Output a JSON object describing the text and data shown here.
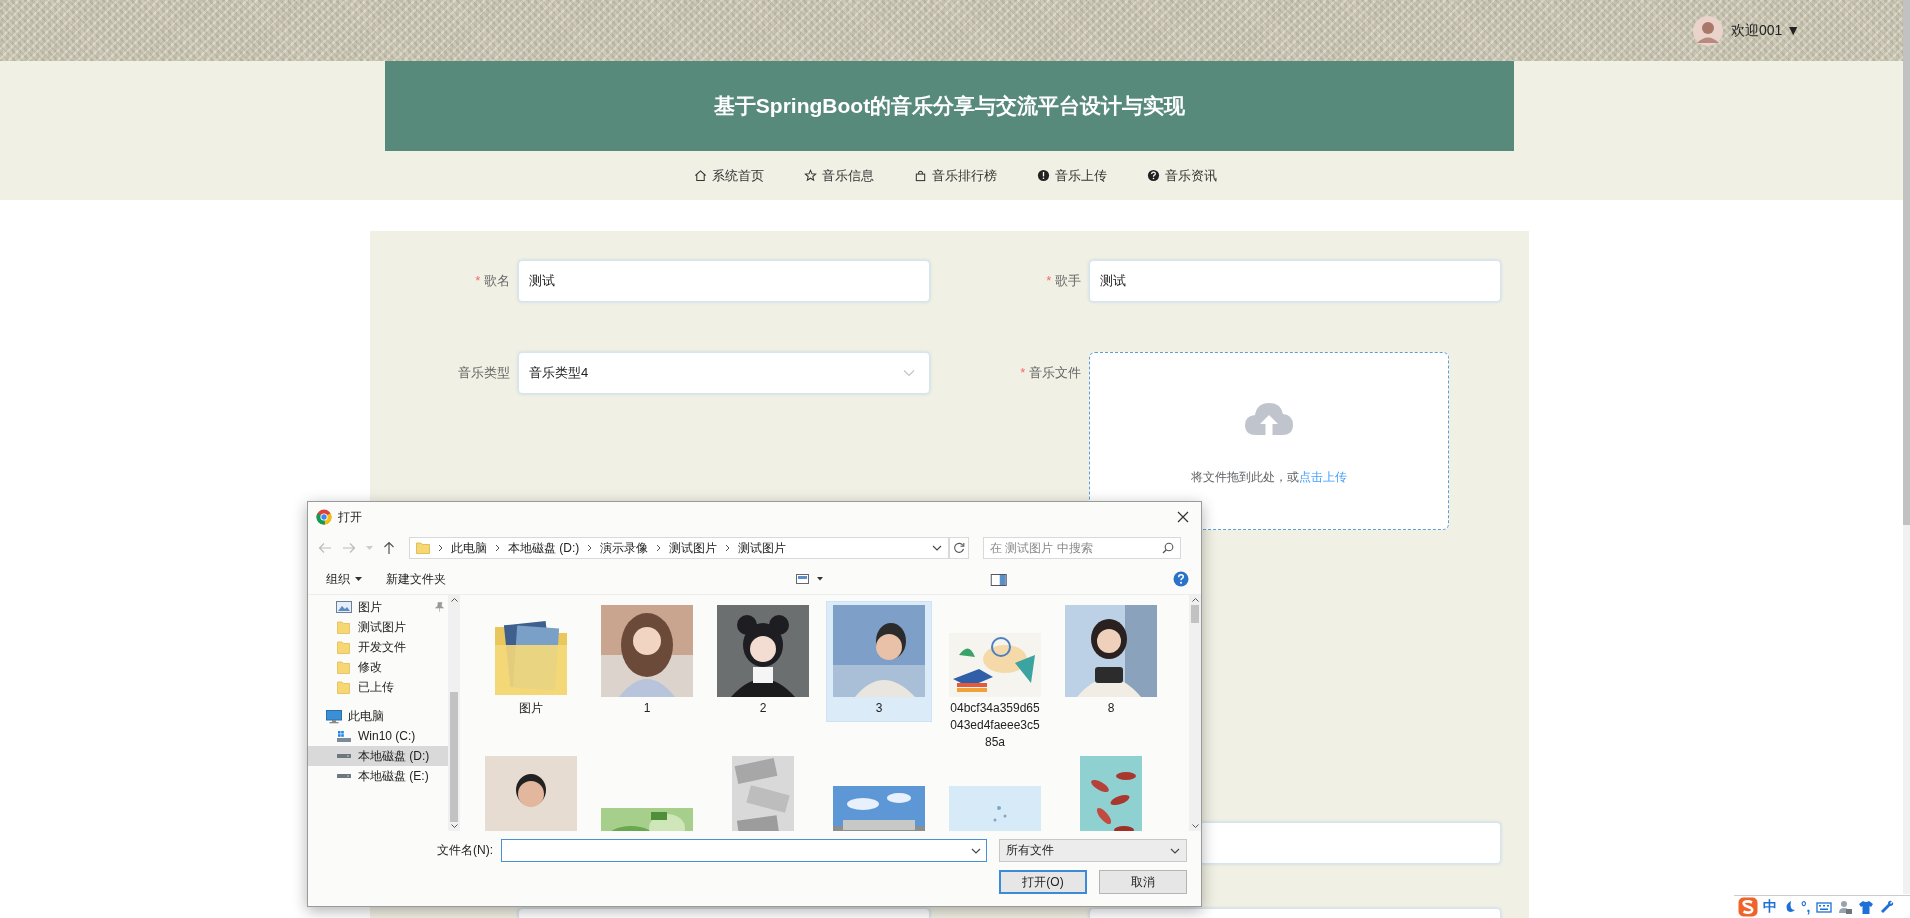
{
  "user_menu": {
    "greeting": "欢迎001",
    "caret": "▼"
  },
  "header": {
    "title": "基于SpringBoot的音乐分享与交流平台设计与实现"
  },
  "nav": [
    {
      "label": "系统首页",
      "kind": "home"
    },
    {
      "label": "音乐信息",
      "kind": "star"
    },
    {
      "label": "音乐排行榜",
      "kind": "bag"
    },
    {
      "label": "音乐上传",
      "kind": "alert"
    },
    {
      "label": "音乐资讯",
      "kind": "help"
    }
  ],
  "form": {
    "rows": [
      {
        "fields": [
          {
            "kind": "input",
            "required_mark": "*",
            "label": "歌名",
            "value": "测试"
          },
          {
            "kind": "input",
            "required_mark": "*",
            "label": "歌手",
            "value": "测试"
          }
        ]
      },
      {
        "fields": [
          {
            "kind": "select",
            "label": "音乐类型",
            "value": "音乐类型4"
          },
          {
            "kind": "upload",
            "required_mark": "*",
            "label": "音乐文件",
            "hint": "将文件拖到此处，或",
            "link": "点击上传"
          }
        ]
      },
      {
        "fields": [
          {
            "kind": "covered"
          },
          {
            "kind": "blank"
          }
        ]
      },
      {
        "fields": [
          {
            "kind": "blank"
          },
          {
            "kind": "blank"
          }
        ]
      }
    ]
  },
  "file_dialog": {
    "title": "打开",
    "breadcrumb": [
      "此电脑",
      "本地磁盘 (D:)",
      "演示录像",
      "测试图片",
      "测试图片"
    ],
    "search": {
      "placeholder": "在 测试图片 中搜索"
    },
    "toolbar": {
      "organize": "组织",
      "new_folder": "新建文件夹"
    },
    "nav_pane": [
      {
        "label": "图片",
        "kind": "pictures",
        "pinned": true,
        "selected": false
      },
      {
        "label": "测试图片",
        "kind": "folder",
        "pinned": false,
        "selected": false
      },
      {
        "label": "开发文件",
        "kind": "folder",
        "pinned": false,
        "selected": false
      },
      {
        "label": "修改",
        "kind": "folder",
        "pinned": false,
        "selected": false
      },
      {
        "label": "已上传",
        "kind": "folder",
        "pinned": false,
        "selected": false
      },
      {
        "label": "此电脑",
        "kind": "pc",
        "pinned": false,
        "selected": false
      },
      {
        "label": "Win10 (C:)",
        "kind": "system-drive",
        "pinned": false,
        "selected": false
      },
      {
        "label": "本地磁盘 (D:)",
        "kind": "drive",
        "pinned": false,
        "selected": true
      },
      {
        "label": "本地磁盘 (E:)",
        "kind": "drive",
        "pinned": false,
        "selected": false
      }
    ],
    "files": [
      {
        "name": "图片",
        "kind": "folder",
        "selected": false
      },
      {
        "name": "1",
        "kind": "picture",
        "selected": false
      },
      {
        "name": "2",
        "kind": "picture",
        "selected": false
      },
      {
        "name": "3",
        "kind": "picture",
        "selected": true
      },
      {
        "name": "04bcf34a359d65043ed4faeee3c585a",
        "kind": "picture",
        "selected": false
      },
      {
        "name": "8",
        "kind": "picture",
        "selected": false
      },
      {
        "kind": "picture",
        "selected": false
      },
      {
        "kind": "picture",
        "selected": false
      },
      {
        "kind": "picture",
        "selected": false
      },
      {
        "kind": "picture",
        "selected": false
      },
      {
        "kind": "picture",
        "selected": false
      },
      {
        "kind": "picture",
        "selected": false
      }
    ],
    "file_name": {
      "label": "文件名(N):"
    },
    "file_type": {
      "value": "所有文件"
    },
    "buttons": [
      {
        "label": "打开(O)",
        "default": true
      },
      {
        "label": "取消",
        "default": false
      }
    ]
  },
  "ime_toolbar": [
    {
      "kind": "logo"
    },
    {
      "kind": "text",
      "text": "中"
    },
    {
      "kind": "moon"
    },
    {
      "kind": "text",
      "text": "°,"
    },
    {
      "kind": "keyboard"
    },
    {
      "kind": "user"
    },
    {
      "kind": "shirt"
    },
    {
      "kind": "wrench"
    }
  ]
}
